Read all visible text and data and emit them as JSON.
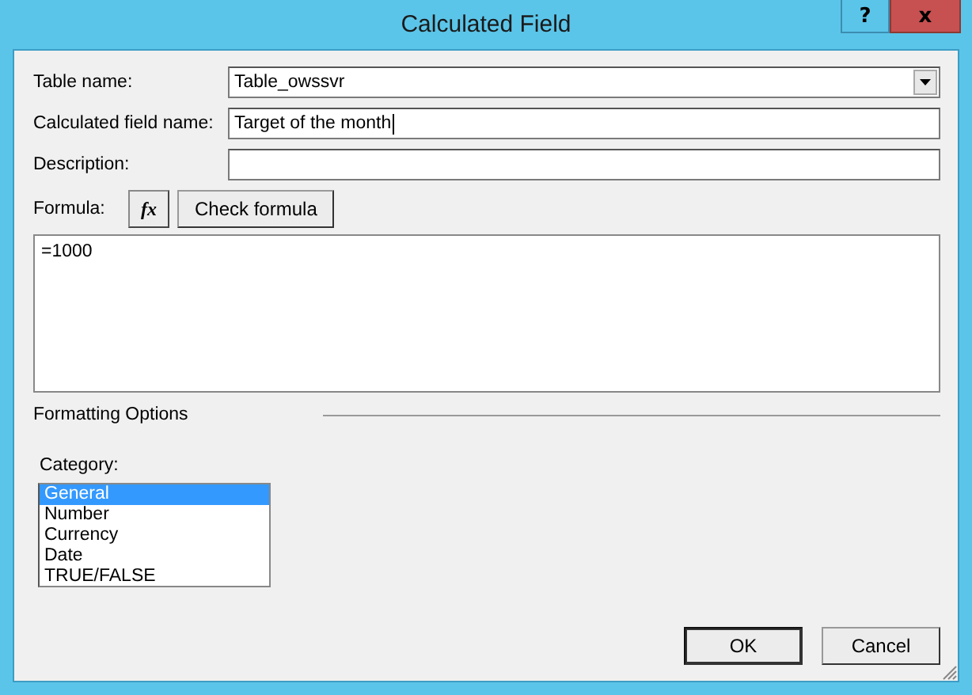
{
  "window": {
    "title": "Calculated Field",
    "help_button": "?",
    "close_button": "x"
  },
  "fields": [
    {
      "label": "Table name:",
      "value": "Table_owssvr",
      "kind": "dropdown"
    },
    {
      "label": "Calculated field name:",
      "value": "Target of the month",
      "kind": "text"
    },
    {
      "label": "Description:",
      "kind": "text"
    }
  ],
  "formula": {
    "label": "Formula:",
    "function_button": "fx",
    "check_button": "Check formula",
    "value": "=1000"
  },
  "formatting": {
    "title": "Formatting Options",
    "category_label": "Category:",
    "categories": [
      {
        "label": "General",
        "selected": true
      },
      {
        "label": "Number",
        "selected": false
      },
      {
        "label": "Currency",
        "selected": false
      },
      {
        "label": "Date",
        "selected": false
      },
      {
        "label": "TRUE/FALSE",
        "selected": false
      }
    ]
  },
  "buttons": [
    {
      "label": "OK",
      "default": true
    },
    {
      "label": "Cancel",
      "default": false
    }
  ]
}
